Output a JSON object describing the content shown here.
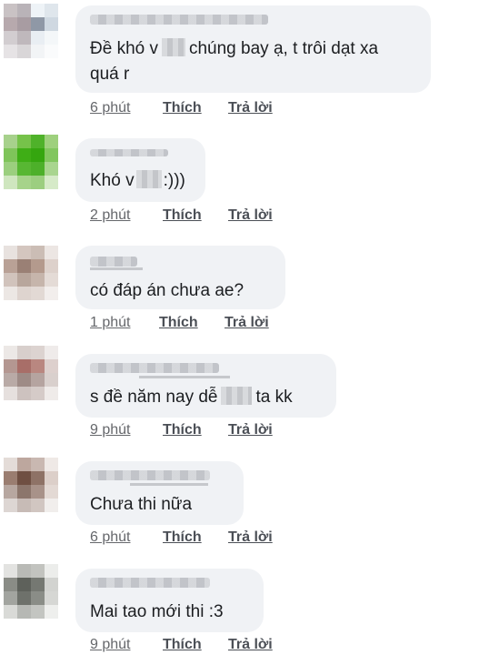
{
  "comments": [
    {
      "line1_a": "Đề khó v",
      "line1_b": "chúng bay ạ, t trôi dạt xa",
      "line2": "quá r",
      "time": "6 phút",
      "like": "Thích",
      "reply": "Trả lời",
      "avatar_colors": [
        "#c9c2c4",
        "#b9b3b8",
        "#eef3f7",
        "#dfe6ec",
        "#b7a9ad",
        "#a89ca2",
        "#8f98a6",
        "#cfd8e1",
        "#d2cdd0",
        "#bfb8bc",
        "#e9eef3",
        "#f4f7f9",
        "#e6e3e5",
        "#d9d6d8",
        "#f2f4f6",
        "#fafbfc"
      ]
    },
    {
      "line1": "Khó v",
      "line1_end": ":)))",
      "time": "2 phút",
      "like": "Thích",
      "reply": "Trả lời",
      "avatar_colors": [
        "#a7d18c",
        "#76c24a",
        "#4fb22a",
        "#9ed07d",
        "#7fc45a",
        "#3fae16",
        "#35a60f",
        "#82c65f",
        "#9bcf7e",
        "#58b733",
        "#4db02a",
        "#a9d58f",
        "#cfe6bf",
        "#a6d38a",
        "#9cce80",
        "#d6eac8"
      ]
    },
    {
      "line1": "có đáp án chưa ae?",
      "time": "1 phút",
      "like": "Thích",
      "reply": "Trả lời",
      "avatar_colors": [
        "#e8e2df",
        "#d4c6bf",
        "#cbbdb5",
        "#ece6e3",
        "#b9a196",
        "#9a8075",
        "#b49a8d",
        "#ddd1cb",
        "#d1c3bc",
        "#b8a69c",
        "#c6b5ab",
        "#e4dbd6",
        "#ece7e4",
        "#ded4cf",
        "#e2d9d4",
        "#f2eeec"
      ]
    },
    {
      "line1_a": "s đề năm nay dễ",
      "line1_b": "ta kk",
      "time": "9 phút",
      "like": "Thích",
      "reply": "Trả lời",
      "avatar_colors": [
        "#ece8e6",
        "#d8cfcc",
        "#dcd3d0",
        "#efebea",
        "#b49791",
        "#a86e68",
        "#b98780",
        "#ddd0cd",
        "#b9aaa6",
        "#9e8b86",
        "#b5a4a0",
        "#d9d0cd",
        "#e6e0de",
        "#cdc2bf",
        "#d5cbc8",
        "#efebe9"
      ]
    },
    {
      "line1": "Chưa thi nữa",
      "time": "6 phút",
      "like": "Thích",
      "reply": "Trả lời",
      "avatar_colors": [
        "#e4dcd8",
        "#bda79e",
        "#c9b8b1",
        "#efe9e6",
        "#9a7d70",
        "#6f4f42",
        "#8e7266",
        "#dccfc9",
        "#b7a7a0",
        "#8c766c",
        "#a89289",
        "#e3d9d4",
        "#ddd6d3",
        "#c7bbb6",
        "#d1c6c1",
        "#f1eeec"
      ]
    },
    {
      "line1": "Mai tao mới thi :3",
      "time": "9 phút",
      "like": "Thích",
      "reply": "Trả lời",
      "avatar_colors": [
        "#e3e3e1",
        "#b9bab6",
        "#c2c3bf",
        "#ecedeb",
        "#8a8c86",
        "#5e615b",
        "#757872",
        "#d2d3d0",
        "#a2a49f",
        "#6e716b",
        "#8a8d87",
        "#d6d7d4",
        "#d9dad7",
        "#b6b8b4",
        "#c3c5c1",
        "#eeefed"
      ]
    }
  ]
}
